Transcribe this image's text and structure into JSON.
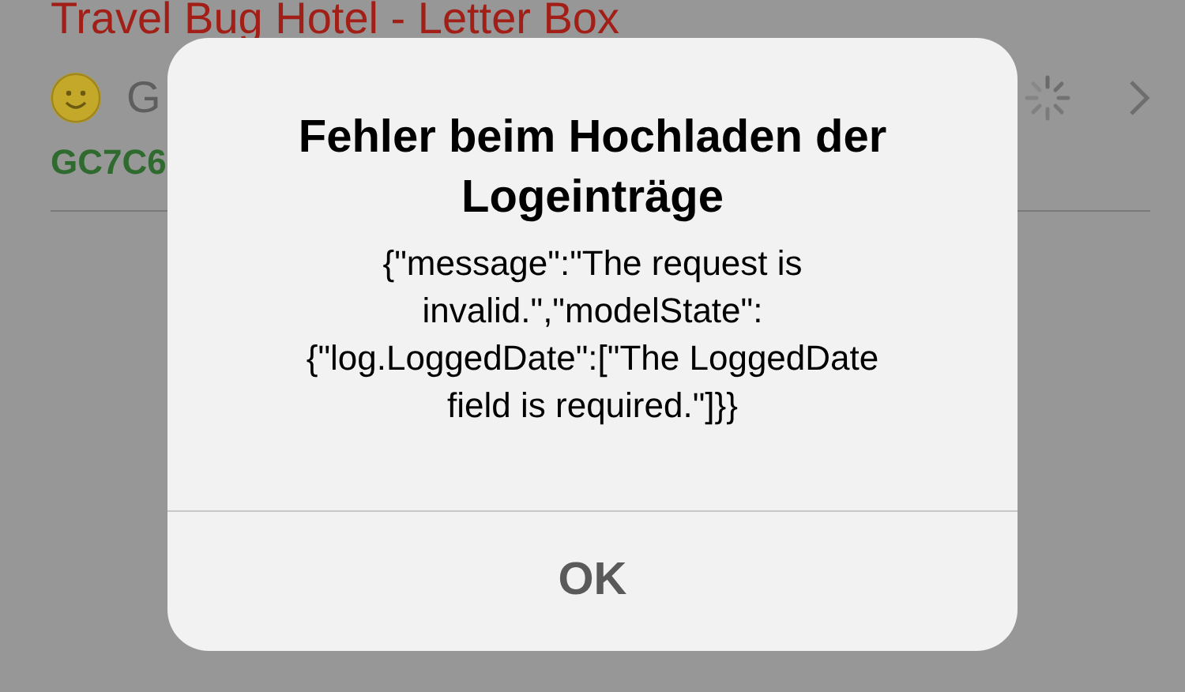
{
  "background": {
    "title": "Travel Bug Hotel - Letter Box",
    "status": "G",
    "code": "GC7C6"
  },
  "alert": {
    "title": "Fehler beim Hochladen der Logeinträge",
    "message": "{\"message\":\"The request is invalid.\",\"modelState\":{\"log.LoggedDate\":[\"The LoggedDate field is required.\"]}}",
    "buttons": [
      "OK"
    ]
  }
}
